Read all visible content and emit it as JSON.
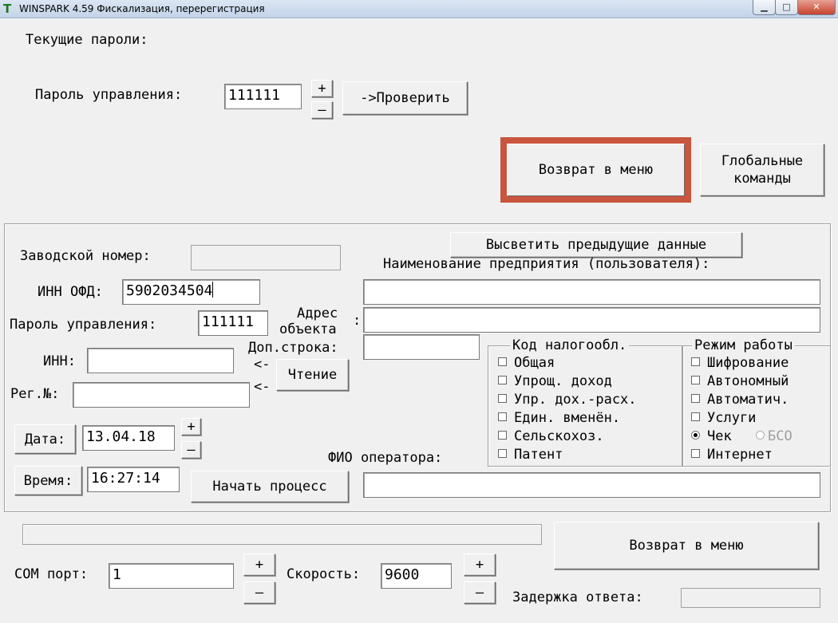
{
  "window": {
    "title": "WINSPARK 4.59 Фискализация, перерегистрация",
    "icon_glyph": "Т",
    "minimize_glyph": "▁",
    "maximize_glyph": "□",
    "close_glyph": "✕"
  },
  "passwords": {
    "heading": "Текущие пароли:",
    "admin_label": "Пароль управления:",
    "admin_value": "111111",
    "plus": "+",
    "minus": "–",
    "check_button": "->Проверить"
  },
  "top_buttons": {
    "return_menu": "Возврат в меню",
    "global_commands_line1": "Глобальные",
    "global_commands_line2": "команды"
  },
  "form": {
    "show_prev_button": "Высветить предыдущие данные",
    "company_name_label": "Наименование предприятия (пользователя):",
    "company_name_value": "",
    "serial_label": "Заводской номер:",
    "serial_value": "",
    "inn_ofd_label": "ИНН ОФД:",
    "inn_ofd_value": "5902034504",
    "admin_pwd_label": "Пароль управления:",
    "admin_pwd_value": "111111",
    "address_label_line1": "Адрес",
    "address_label_line2": "объекта",
    "address_colon": ":",
    "address_value": "",
    "extra_line_label": "Доп.строка:",
    "extra_line_value": "",
    "inn_label": "ИНН:",
    "inn_value": "",
    "arrow1": "<-",
    "arrow2": "<-",
    "read_button": "Чтение",
    "reg_label": "Рег.№:",
    "reg_value": "",
    "date_button": "Дата:",
    "date_value": "13.04.18",
    "time_button": "Время:",
    "time_value": "16:27:14",
    "plus": "+",
    "minus": "–",
    "start_button": "Начать процесс",
    "operator_label": "ФИО оператора:",
    "operator_value": ""
  },
  "tax_group": {
    "title": "Код налогообл.",
    "items": [
      "Общая",
      "Упрощ. доход",
      "Упр. дох.-расх.",
      "Един. вменён.",
      "Сельскохоз.",
      "Патент"
    ]
  },
  "mode_group": {
    "title": "Режим работы",
    "items": [
      "Шифрование",
      "Автономный",
      "Автоматич.",
      "Услуги"
    ],
    "radio_check": "Чек",
    "radio_bso": "БСО",
    "radio_selected": "Чек",
    "internet": "Интернет"
  },
  "bottom": {
    "return_menu": "Возврат в меню",
    "com_label": "COM порт:",
    "com_value": "1",
    "speed_label": "Скорость:",
    "speed_value": "9600",
    "plus": "+",
    "minus": "–",
    "delay_label": "Задержка ответа:",
    "delay_value": "",
    "progress": 0
  },
  "colors": {
    "highlight_border": "#c8553d",
    "window_bg": "#f0f0f0"
  }
}
